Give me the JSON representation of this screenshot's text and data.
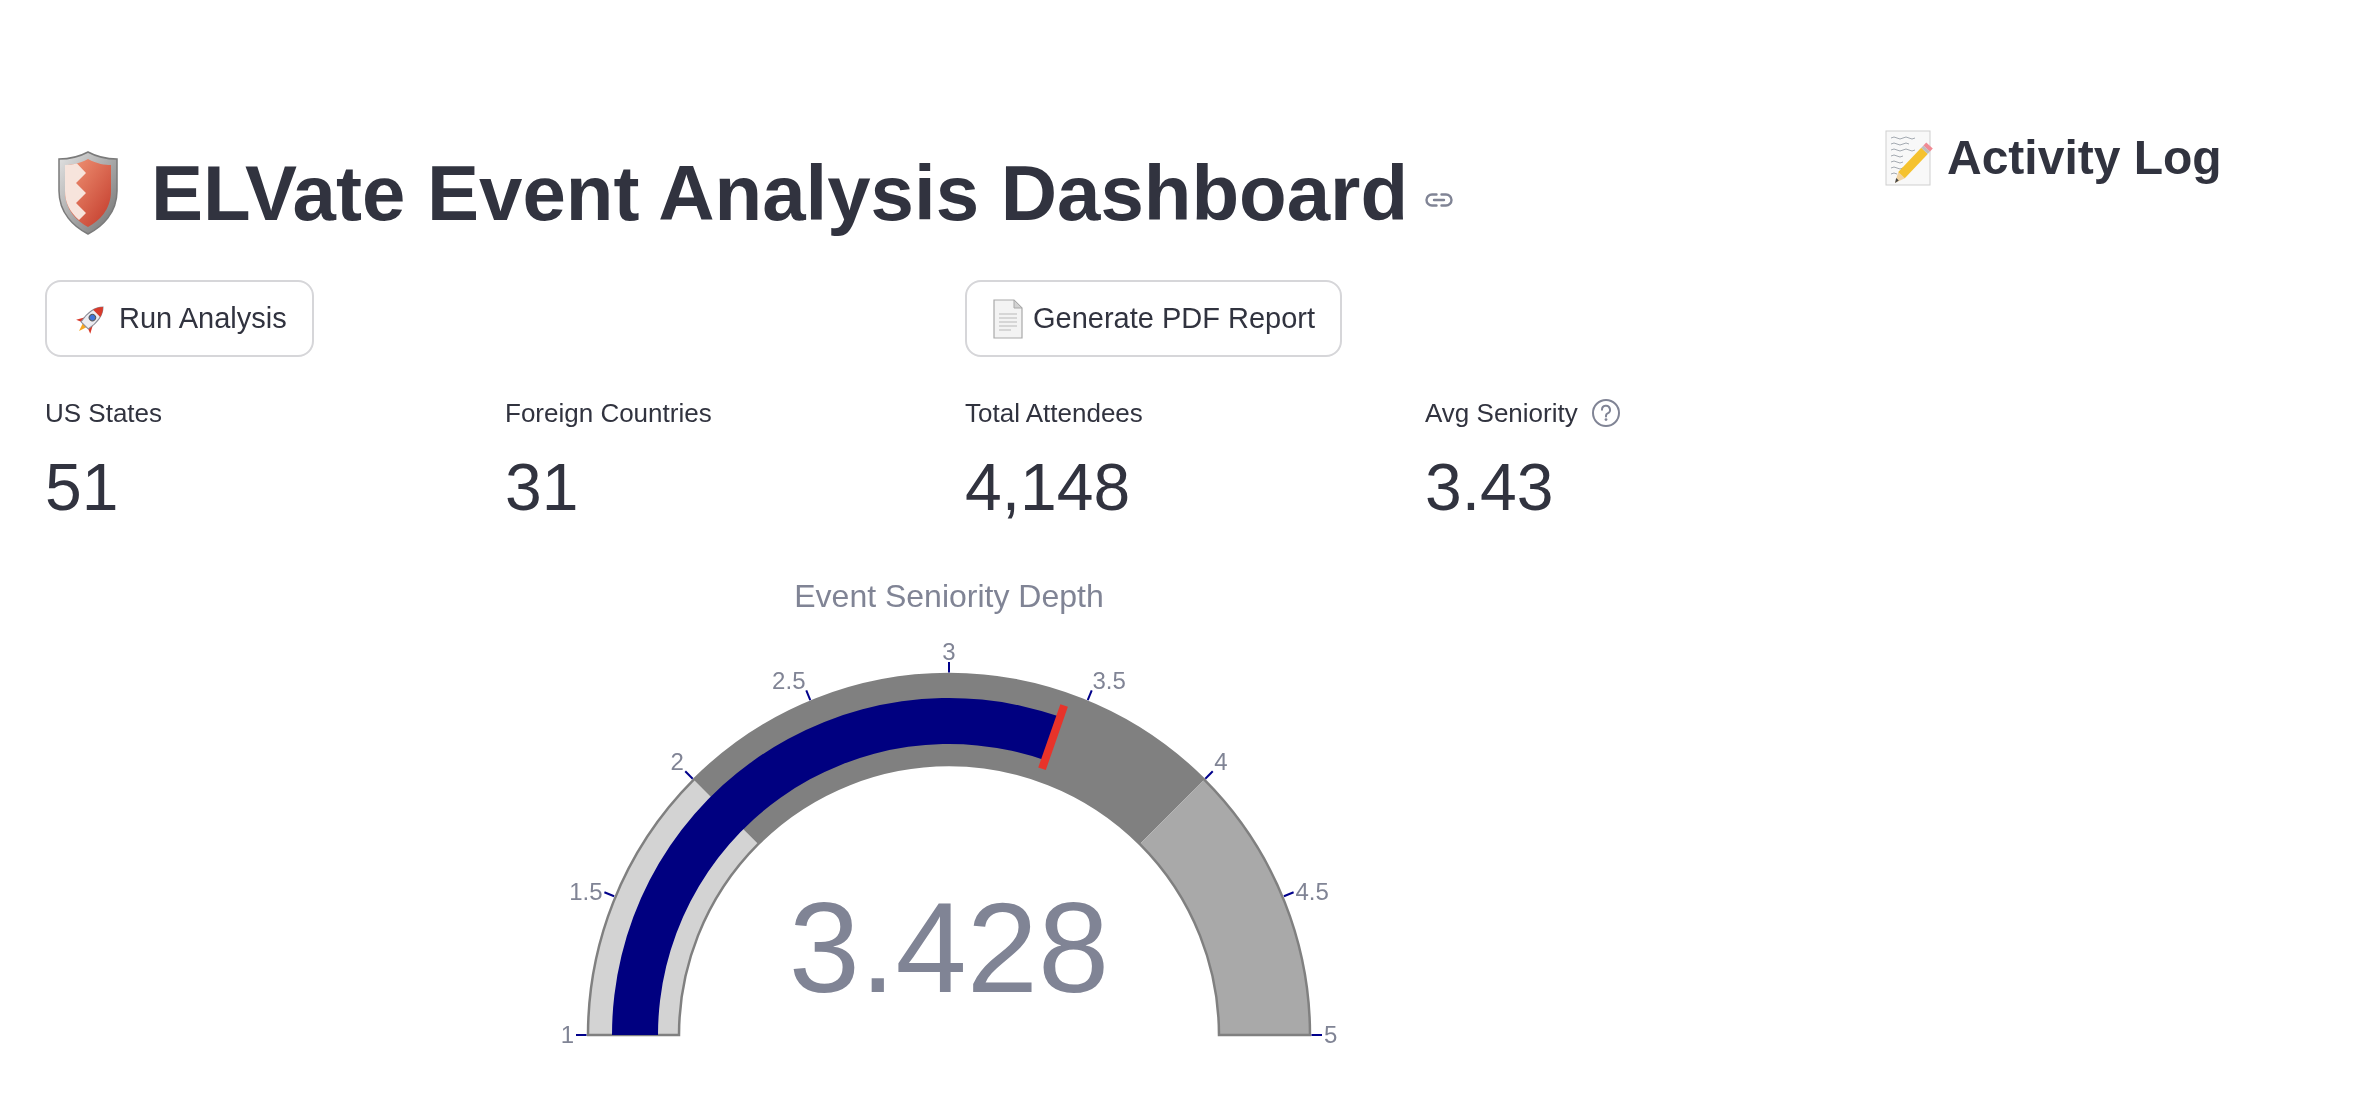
{
  "title_bar": {
    "title": "ELVate Event Analysis Dashboard"
  },
  "run_button": {
    "label": "Run Analysis"
  },
  "report_button": {
    "label": "Generate PDF Report"
  },
  "metrics": [
    {
      "label": "US States",
      "value": "51",
      "help": false
    },
    {
      "label": "Foreign Countries",
      "value": "31",
      "help": false
    },
    {
      "label": "Total Attendees",
      "value": "4,148",
      "help": false
    },
    {
      "label": "Avg Seniority",
      "value": "3.43",
      "help": true
    }
  ],
  "gauge": {
    "title": "Event Seniority Depth",
    "value": "3.428",
    "ticks": [
      "1",
      "1.5",
      "2",
      "2.5",
      "3",
      "3.5",
      "4",
      "4.5",
      "5"
    ],
    "steps": [
      {
        "color": "#d3d3d3"
      },
      {
        "color": "#808080"
      },
      {
        "color": "#a9a9a9"
      }
    ]
  },
  "activity_log": {
    "title": "Activity Log"
  }
}
